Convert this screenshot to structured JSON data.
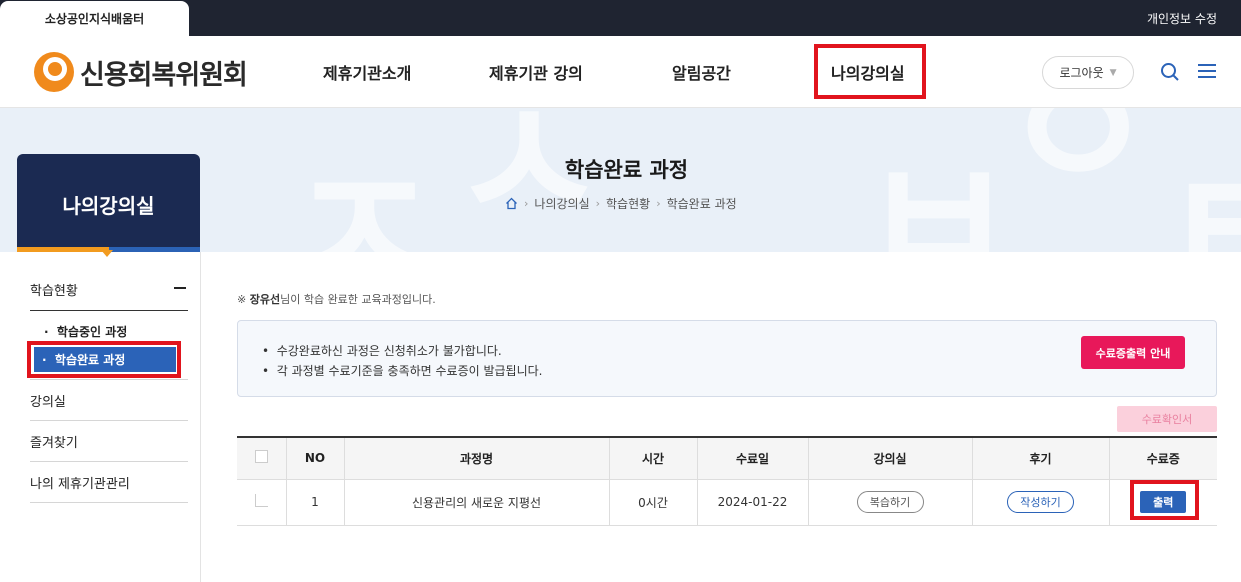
{
  "topbar": {
    "tab_label": "소상공인지식배움터",
    "privacy_label": "개인정보 수정"
  },
  "header": {
    "logo_text": "신용회복위원회",
    "nav": [
      "제휴기관소개",
      "제휴기관 강의",
      "알림공간",
      "나의강의실"
    ],
    "logout_label": "로그아웃"
  },
  "banner": {
    "title": "학습완료 과정",
    "breadcrumb": [
      "나의강의실",
      "학습현황",
      "학습완료 과정"
    ]
  },
  "sidebar": {
    "title": "나의강의실",
    "menu": {
      "learning_status": "학습현황",
      "sub_in_progress": "학습중인 과정",
      "sub_completed": "학습완료 과정",
      "classroom": "강의실",
      "favorites": "즐겨찾기",
      "partner_mgmt": "나의 제휴기관관리"
    }
  },
  "content": {
    "notice_name": "장유선",
    "notice_rest": "님이 학습 완료한 교육과정입니다.",
    "info_lines": [
      "수강완료하신 과정은 신청취소가 불가합니다.",
      "각 과정별 수료기준을 충족하면 수료증이 발급됩니다."
    ],
    "cert_guide_label": "수료증출력 안내",
    "cert_confirm_label": "수료확인서",
    "table": {
      "headers": [
        "NO",
        "과정명",
        "시간",
        "수료일",
        "강의실",
        "후기",
        "수료증"
      ],
      "rows": [
        {
          "no": "1",
          "course": "신용관리의 새로운 지평선",
          "time": "0시간",
          "date": "2024-01-22",
          "classroom_btn": "복습하기",
          "review_btn": "작성하기",
          "cert_btn": "출력"
        }
      ]
    }
  },
  "colors": {
    "accent_blue": "#2b63b8",
    "navy": "#1b2a52",
    "brand_orange": "#f08a1c",
    "pink": "#e8185a",
    "highlight_red": "#e1141d"
  }
}
